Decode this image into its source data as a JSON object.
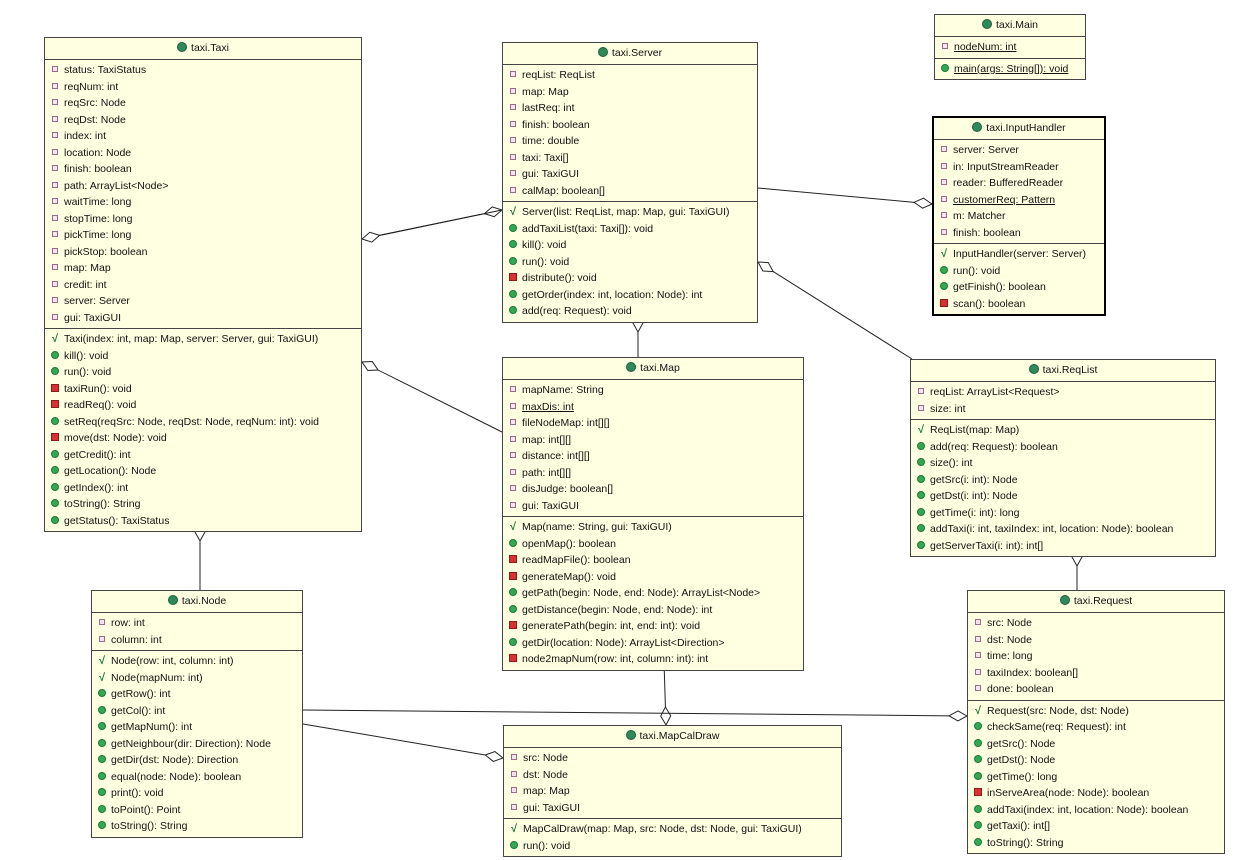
{
  "classes": [
    {
      "id": "taxi",
      "name": "taxi.Taxi",
      "fields": [
        {
          "icon": "private-field-icon",
          "text": "status: TaxiStatus"
        },
        {
          "icon": "private-field-icon",
          "text": "reqNum: int"
        },
        {
          "icon": "private-field-icon",
          "text": "reqSrc: Node"
        },
        {
          "icon": "private-field-icon",
          "text": "reqDst: Node"
        },
        {
          "icon": "private-field-icon",
          "text": "index: int"
        },
        {
          "icon": "private-field-icon",
          "text": "location: Node"
        },
        {
          "icon": "private-field-icon",
          "text": "finish: boolean"
        },
        {
          "icon": "private-field-icon",
          "text": "path: ArrayList<Node>"
        },
        {
          "icon": "private-field-icon",
          "text": "waitTime: long"
        },
        {
          "icon": "private-field-icon",
          "text": "stopTime: long"
        },
        {
          "icon": "private-field-icon",
          "text": "pickTime: long"
        },
        {
          "icon": "private-field-icon",
          "text": "pickStop: boolean"
        },
        {
          "icon": "private-field-icon",
          "text": "map: Map"
        },
        {
          "icon": "private-field-icon",
          "text": "credit: int"
        },
        {
          "icon": "private-field-icon",
          "text": "server: Server"
        },
        {
          "icon": "private-field-icon",
          "text": "gui: TaxiGUI"
        }
      ],
      "methods": [
        {
          "icon": "constructor-icon",
          "text": "Taxi(index: int, map: Map, server: Server, gui: TaxiGUI)"
        },
        {
          "icon": "public-method-icon",
          "text": "kill(): void"
        },
        {
          "icon": "public-method-icon",
          "text": "run(): void"
        },
        {
          "icon": "private-method-icon",
          "text": "taxiRun(): void"
        },
        {
          "icon": "private-method-icon",
          "text": "readReq(): void"
        },
        {
          "icon": "public-method-icon",
          "text": "setReq(reqSrc: Node, reqDst: Node, reqNum: int): void"
        },
        {
          "icon": "private-method-icon",
          "text": "move(dst: Node): void"
        },
        {
          "icon": "public-method-icon",
          "text": "getCredit(): int"
        },
        {
          "icon": "public-method-icon",
          "text": "getLocation(): Node"
        },
        {
          "icon": "public-method-icon",
          "text": "getIndex(): int"
        },
        {
          "icon": "public-method-icon",
          "text": "toString(): String"
        },
        {
          "icon": "public-method-icon",
          "text": "getStatus(): TaxiStatus"
        }
      ]
    },
    {
      "id": "server",
      "name": "taxi.Server",
      "fields": [
        {
          "icon": "private-field-icon",
          "text": "reqList: ReqList"
        },
        {
          "icon": "private-field-icon",
          "text": "map: Map"
        },
        {
          "icon": "private-field-icon",
          "text": "lastReq: int"
        },
        {
          "icon": "private-field-icon",
          "text": "finish: boolean"
        },
        {
          "icon": "private-field-icon",
          "text": "time: double"
        },
        {
          "icon": "private-field-icon",
          "text": "taxi: Taxi[]"
        },
        {
          "icon": "private-field-icon",
          "text": "gui: TaxiGUI"
        },
        {
          "icon": "private-field-icon",
          "text": "calMap: boolean[]"
        }
      ],
      "methods": [
        {
          "icon": "constructor-icon",
          "text": "Server(list: ReqList, map: Map, gui: TaxiGUI)"
        },
        {
          "icon": "public-method-icon",
          "text": "addTaxiList(taxi: Taxi[]): void"
        },
        {
          "icon": "public-method-icon",
          "text": "kill(): void"
        },
        {
          "icon": "public-method-icon",
          "text": "run(): void"
        },
        {
          "icon": "private-method-icon",
          "text": "distribute(): void"
        },
        {
          "icon": "public-method-icon",
          "text": "getOrder(index: int, location: Node): int"
        },
        {
          "icon": "public-method-icon",
          "text": "add(req: Request): void"
        }
      ]
    },
    {
      "id": "main",
      "name": "taxi.Main",
      "fields": [
        {
          "icon": "private-field-icon",
          "text": "nodeNum: int",
          "static": true
        }
      ],
      "methods": [
        {
          "icon": "public-method-icon",
          "text": "main(args: String[]): void",
          "static": true
        }
      ]
    },
    {
      "id": "inputhandler",
      "name": "taxi.InputHandler",
      "fields": [
        {
          "icon": "private-field-icon",
          "text": "server: Server"
        },
        {
          "icon": "private-field-icon",
          "text": "in: InputStreamReader"
        },
        {
          "icon": "private-field-icon",
          "text": "reader: BufferedReader"
        },
        {
          "icon": "private-field-icon",
          "text": "customerReq: Pattern",
          "static": true
        },
        {
          "icon": "private-field-icon",
          "text": "m: Matcher"
        },
        {
          "icon": "private-field-icon",
          "text": "finish: boolean"
        }
      ],
      "methods": [
        {
          "icon": "constructor-icon",
          "text": "InputHandler(server: Server)"
        },
        {
          "icon": "public-method-icon",
          "text": "run(): void"
        },
        {
          "icon": "public-method-icon",
          "text": "getFinish(): boolean"
        },
        {
          "icon": "private-method-icon",
          "text": "scan(): boolean"
        }
      ]
    },
    {
      "id": "map",
      "name": "taxi.Map",
      "fields": [
        {
          "icon": "private-field-icon",
          "text": "mapName: String"
        },
        {
          "icon": "private-field-icon",
          "text": "maxDis: int",
          "static": true
        },
        {
          "icon": "private-field-icon",
          "text": "fileNodeMap: int[][]"
        },
        {
          "icon": "private-field-icon",
          "text": "map: int[][]"
        },
        {
          "icon": "private-field-icon",
          "text": "distance: int[][]"
        },
        {
          "icon": "private-field-icon",
          "text": "path: int[][]"
        },
        {
          "icon": "private-field-icon",
          "text": "disJudge: boolean[]"
        },
        {
          "icon": "private-field-icon",
          "text": "gui: TaxiGUI"
        }
      ],
      "methods": [
        {
          "icon": "constructor-icon",
          "text": "Map(name: String, gui: TaxiGUI)"
        },
        {
          "icon": "public-method-icon",
          "text": "openMap(): boolean"
        },
        {
          "icon": "private-method-icon",
          "text": "readMapFile(): boolean"
        },
        {
          "icon": "private-method-icon",
          "text": "generateMap(): void"
        },
        {
          "icon": "public-method-icon",
          "text": "getPath(begin: Node, end: Node): ArrayList<Node>"
        },
        {
          "icon": "public-method-icon",
          "text": "getDistance(begin: Node, end: Node): int"
        },
        {
          "icon": "private-method-icon",
          "text": "generatePath(begin: int, end: int): void"
        },
        {
          "icon": "public-method-icon",
          "text": "getDir(location: Node): ArrayList<Direction>"
        },
        {
          "icon": "private-method-icon",
          "text": "node2mapNum(row: int, column: int): int"
        }
      ]
    },
    {
      "id": "reqlist",
      "name": "taxi.ReqList",
      "fields": [
        {
          "icon": "private-field-icon",
          "text": "reqList: ArrayList<Request>"
        },
        {
          "icon": "private-field-icon",
          "text": "size: int"
        }
      ],
      "methods": [
        {
          "icon": "constructor-icon",
          "text": "ReqList(map: Map)"
        },
        {
          "icon": "public-method-icon",
          "text": "add(req: Request): boolean"
        },
        {
          "icon": "public-method-icon",
          "text": "size(): int"
        },
        {
          "icon": "public-method-icon",
          "text": "getSrc(i: int): Node"
        },
        {
          "icon": "public-method-icon",
          "text": "getDst(i: int): Node"
        },
        {
          "icon": "public-method-icon",
          "text": "getTime(i: int): long"
        },
        {
          "icon": "public-method-icon",
          "text": "addTaxi(i: int, taxiIndex: int, location: Node): boolean"
        },
        {
          "icon": "public-method-icon",
          "text": "getServerTaxi(i: int): int[]"
        }
      ]
    },
    {
      "id": "node",
      "name": "taxi.Node",
      "fields": [
        {
          "icon": "private-field-icon",
          "text": "row: int"
        },
        {
          "icon": "private-field-icon",
          "text": "column: int"
        }
      ],
      "methods": [
        {
          "icon": "constructor-icon",
          "text": "Node(row: int, column: int)"
        },
        {
          "icon": "constructor-icon",
          "text": "Node(mapNum: int)"
        },
        {
          "icon": "public-method-icon",
          "text": "getRow(): int"
        },
        {
          "icon": "public-method-icon",
          "text": "getCol(): int"
        },
        {
          "icon": "public-method-icon",
          "text": "getMapNum(): int"
        },
        {
          "icon": "public-method-icon",
          "text": "getNeighbour(dir: Direction): Node"
        },
        {
          "icon": "public-method-icon",
          "text": "getDir(dst: Node): Direction"
        },
        {
          "icon": "public-method-icon",
          "text": "equal(node: Node): boolean"
        },
        {
          "icon": "public-method-icon",
          "text": "print(): void"
        },
        {
          "icon": "public-method-icon",
          "text": "toPoint(): Point"
        },
        {
          "icon": "public-method-icon",
          "text": "toString(): String"
        }
      ]
    },
    {
      "id": "mapcaldraw",
      "name": "taxi.MapCalDraw",
      "fields": [
        {
          "icon": "private-field-icon",
          "text": "src: Node"
        },
        {
          "icon": "private-field-icon",
          "text": "dst: Node"
        },
        {
          "icon": "private-field-icon",
          "text": "map: Map"
        },
        {
          "icon": "private-field-icon",
          "text": "gui: TaxiGUI"
        }
      ],
      "methods": [
        {
          "icon": "constructor-icon",
          "text": "MapCalDraw(map: Map, src: Node, dst: Node, gui: TaxiGUI)"
        },
        {
          "icon": "public-method-icon",
          "text": "run(): void"
        }
      ]
    },
    {
      "id": "request",
      "name": "taxi.Request",
      "fields": [
        {
          "icon": "private-field-icon",
          "text": "src: Node"
        },
        {
          "icon": "private-field-icon",
          "text": "dst: Node"
        },
        {
          "icon": "private-field-icon",
          "text": "time: long"
        },
        {
          "icon": "private-field-icon",
          "text": "taxiIndex: boolean[]"
        },
        {
          "icon": "private-field-icon",
          "text": "done: boolean"
        }
      ],
      "methods": [
        {
          "icon": "constructor-icon",
          "text": "Request(src: Node, dst: Node)"
        },
        {
          "icon": "public-method-icon",
          "text": "checkSame(req: Request): int"
        },
        {
          "icon": "public-method-icon",
          "text": "getSrc(): Node"
        },
        {
          "icon": "public-method-icon",
          "text": "getDst(): Node"
        },
        {
          "icon": "public-method-icon",
          "text": "getTime(): long"
        },
        {
          "icon": "private-method-icon",
          "text": "inServeArea(node: Node): boolean"
        },
        {
          "icon": "public-method-icon",
          "text": "addTaxi(index: int, location: Node): boolean"
        },
        {
          "icon": "public-method-icon",
          "text": "getTaxi(): int[]"
        },
        {
          "icon": "public-method-icon",
          "text": "toString(): String"
        }
      ]
    }
  ],
  "associations": [
    {
      "from": "server",
      "to": "taxi",
      "kind": "aggregation",
      "diamond_at": "from"
    },
    {
      "from": "taxi",
      "to": "server",
      "kind": "aggregation",
      "diamond_at": "from"
    },
    {
      "from": "inputhandler",
      "to": "server",
      "kind": "aggregation",
      "diamond_at": "from"
    },
    {
      "from": "server",
      "to": "map",
      "kind": "aggregation",
      "diamond_at": "from"
    },
    {
      "from": "server",
      "to": "reqlist",
      "kind": "aggregation",
      "diamond_at": "from"
    },
    {
      "from": "taxi",
      "to": "map",
      "kind": "aggregation",
      "diamond_at": "from"
    },
    {
      "from": "taxi",
      "to": "node",
      "kind": "aggregation",
      "diamond_at": "from"
    },
    {
      "from": "reqlist",
      "to": "request",
      "kind": "aggregation",
      "diamond_at": "from"
    },
    {
      "from": "mapcaldraw",
      "to": "map",
      "kind": "aggregation",
      "diamond_at": "from"
    },
    {
      "from": "mapcaldraw",
      "to": "node",
      "kind": "aggregation",
      "diamond_at": "from"
    },
    {
      "from": "request",
      "to": "node",
      "kind": "aggregation",
      "diamond_at": "from"
    }
  ],
  "colors": {
    "box_fill": "#ffffe1",
    "border": "#444444",
    "class_icon": "#2e8b57",
    "public": "#34a853",
    "private_method": "#d93030"
  }
}
